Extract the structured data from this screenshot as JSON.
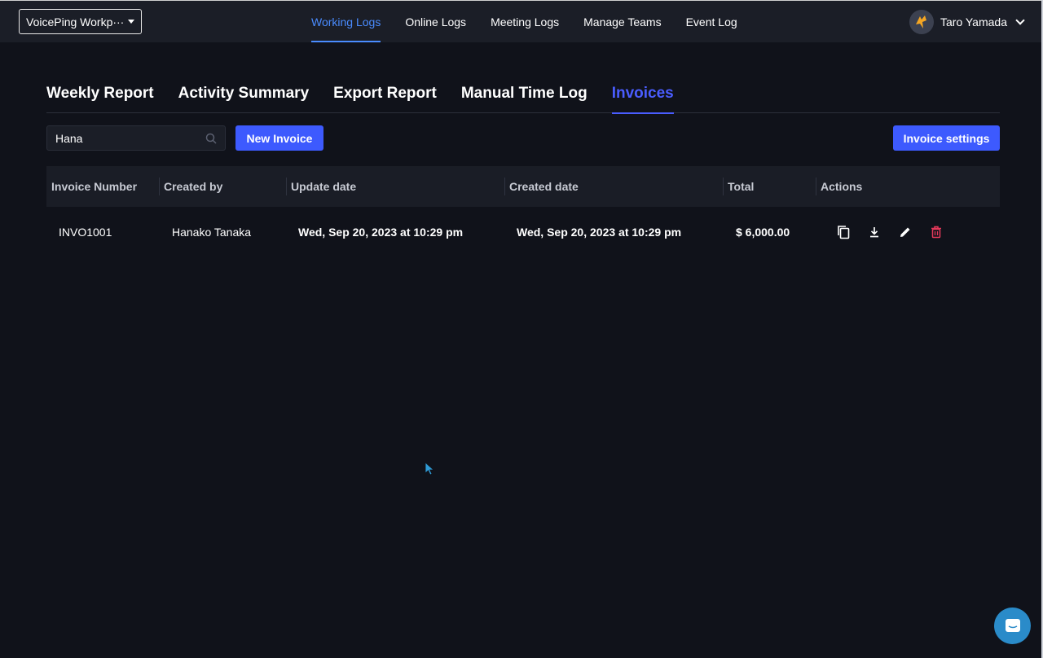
{
  "topbar": {
    "workspace_label": "VoicePing Workp···",
    "nav": [
      {
        "label": "Working Logs",
        "active": true
      },
      {
        "label": "Online Logs",
        "active": false
      },
      {
        "label": "Meeting Logs",
        "active": false
      },
      {
        "label": "Manage Teams",
        "active": false
      },
      {
        "label": "Event Log",
        "active": false
      }
    ],
    "user_name": "Taro Yamada"
  },
  "tabs": [
    {
      "label": "Weekly Report",
      "active": false
    },
    {
      "label": "Activity Summary",
      "active": false
    },
    {
      "label": "Export Report",
      "active": false
    },
    {
      "label": "Manual Time Log",
      "active": false
    },
    {
      "label": "Invoices",
      "active": true
    }
  ],
  "toolbar": {
    "search_value": "Hana",
    "new_invoice_label": "New Invoice",
    "invoice_settings_label": "Invoice settings"
  },
  "table": {
    "headers": [
      "Invoice Number",
      "Created by",
      "Update date",
      "Created date",
      "Total",
      "Actions"
    ],
    "rows": [
      {
        "invoice_number": "INVO1001",
        "created_by": "Hanako Tanaka",
        "update_date": "Wed, Sep 20, 2023 at 10:29 pm",
        "created_date": "Wed, Sep 20, 2023 at 10:29 pm",
        "total": "$ 6,000.00",
        "actions": [
          "copy-icon",
          "download-icon",
          "edit-icon",
          "delete-icon"
        ]
      }
    ]
  },
  "colors": {
    "accent": "#3d5afe",
    "nav_active": "#4a8cff",
    "delete": "#e5395a",
    "chat": "#2a8bc9"
  }
}
